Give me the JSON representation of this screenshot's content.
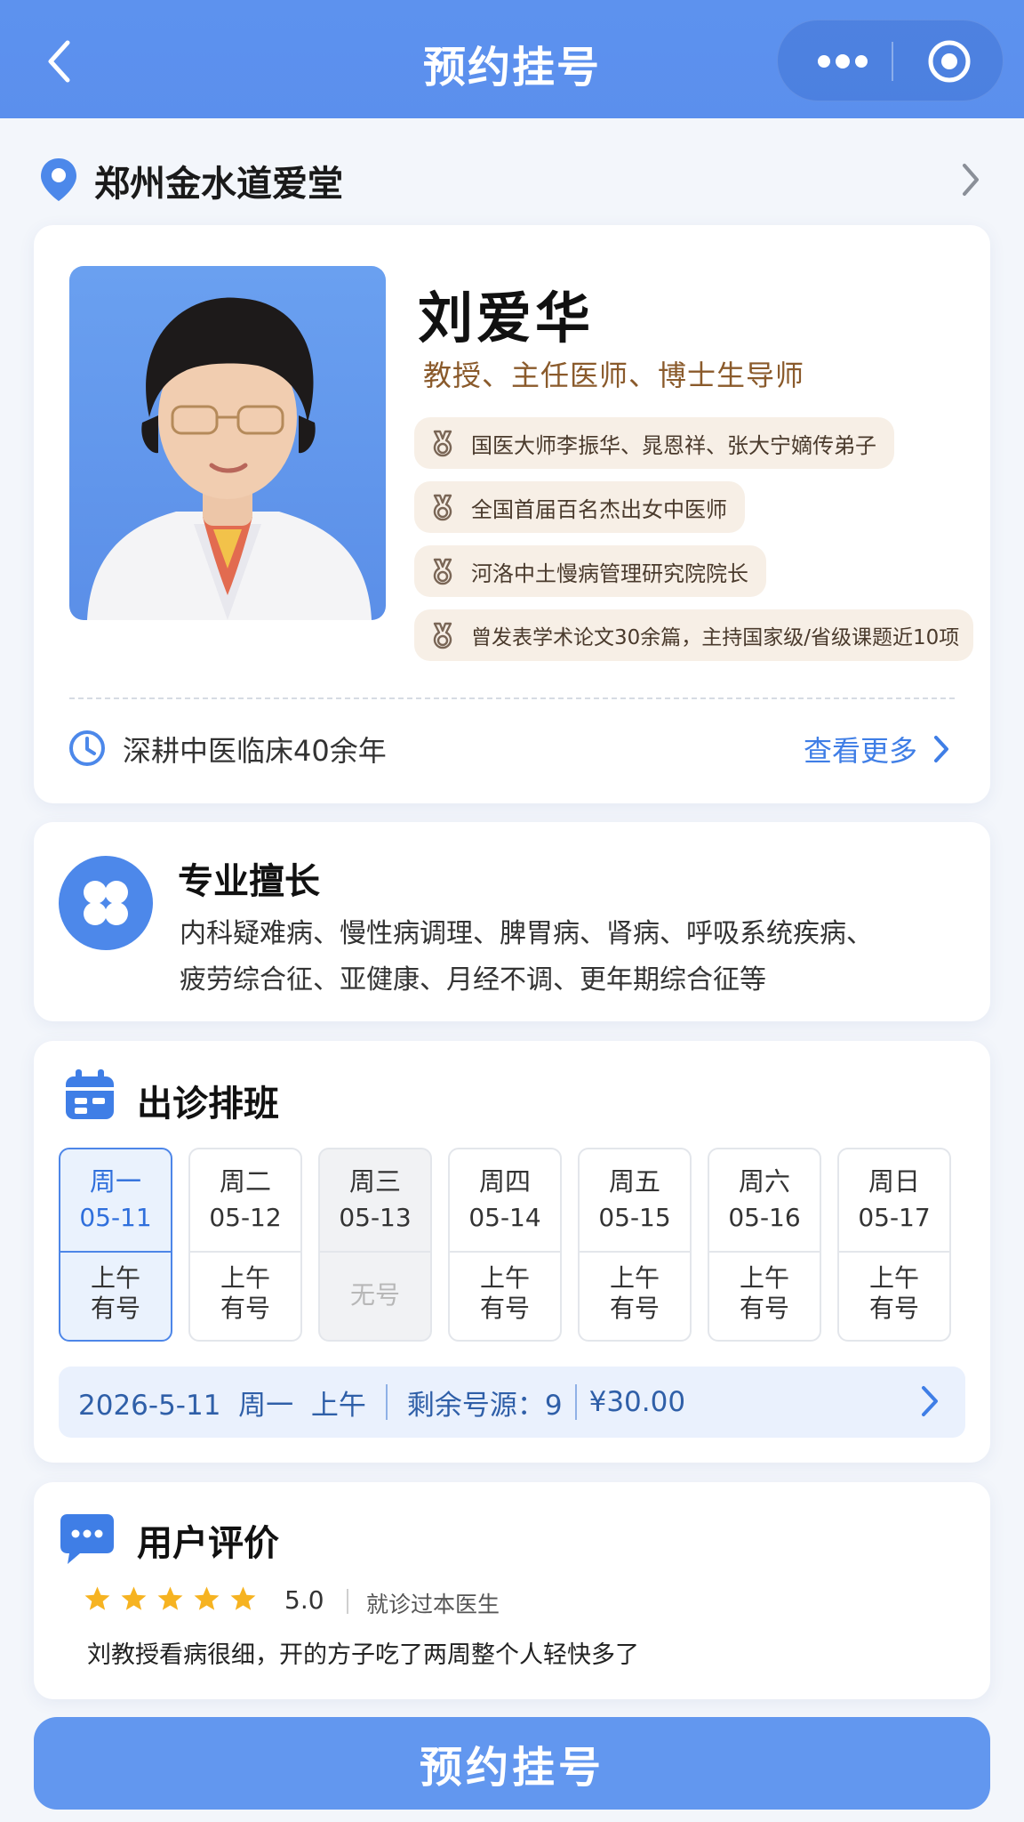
{
  "navbar": {
    "title": "预约挂号"
  },
  "location": {
    "name": "郑州金水道爱堂"
  },
  "doctor": {
    "name": "刘爱华",
    "title": "教授、主任医师、博士生导师",
    "tags": [
      "国医大师李振华、晁恩祥、张大宁嫡传弟子",
      "全国首届百名杰出女中医师",
      "河洛中土慢病管理研究院院长",
      "曾发表学术论文30余篇，主持国家级/省级课题近10项"
    ],
    "experience": "深耕中医临床40余年",
    "more_label": "查看更多"
  },
  "specialty": {
    "title": "专业擅长",
    "line1": "内科疑难病、慢性病调理、脾胃病、肾病、呼吸系统疾病、",
    "line2": "疲劳综合征、亚健康、月经不调、更年期综合征等"
  },
  "schedule": {
    "title": "出诊排班",
    "days": [
      {
        "weekday": "周一",
        "date": "05-11",
        "period": "上午",
        "status": "有号"
      },
      {
        "weekday": "周二",
        "date": "05-12",
        "period": "上午",
        "status": "有号"
      },
      {
        "weekday": "周三",
        "date": "05-13",
        "period": "",
        "status": "无号"
      },
      {
        "weekday": "周四",
        "date": "05-14",
        "period": "上午",
        "status": "有号"
      },
      {
        "weekday": "周五",
        "date": "05-15",
        "period": "上午",
        "status": "有号"
      },
      {
        "weekday": "周六",
        "date": "05-16",
        "period": "上午",
        "status": "有号"
      },
      {
        "weekday": "周日",
        "date": "05-17",
        "period": "上午",
        "status": "有号"
      }
    ],
    "selected": {
      "datetime": "2026-5-11  周一  上午",
      "remaining": "剩余号源：9",
      "price": "¥30.00"
    }
  },
  "reviews": {
    "title": "用户评价",
    "rating": "5.0",
    "tag": "就诊过本医生",
    "comment": "刘教授看病很细，开的方子吃了两周整个人轻快多了",
    "star_count": 5
  },
  "book_button": {
    "label": "预约挂号"
  },
  "colors": {
    "primary": "#5b8fed",
    "accent_text": "#3f7ee6",
    "tag_bg": "#f7efe6",
    "star": "#f6b321"
  }
}
